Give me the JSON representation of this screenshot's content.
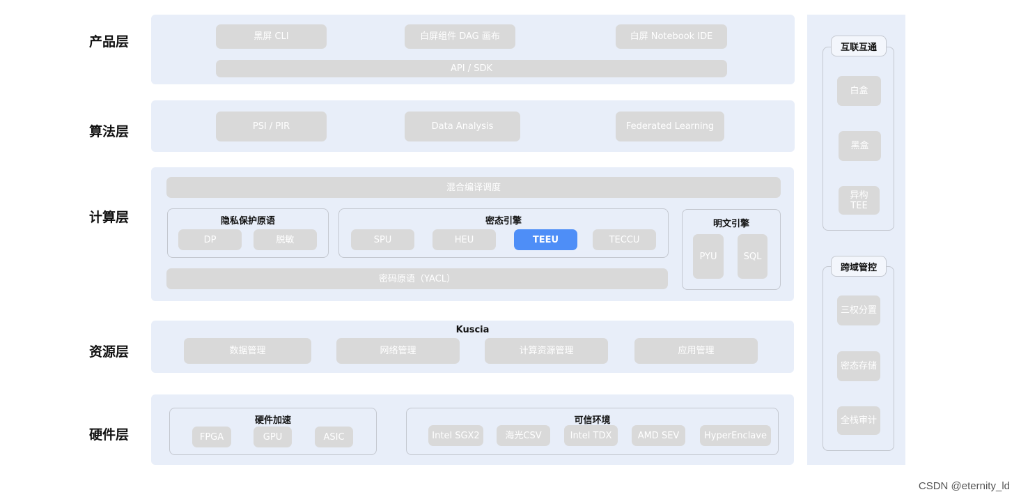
{
  "layers": {
    "product": "产品层",
    "algorithm": "算法层",
    "compute": "计算层",
    "resource": "资源层",
    "hardware": "硬件层"
  },
  "product": {
    "items": [
      "黑屏 CLI",
      "白屏组件 DAG 画布",
      "白屏 Notebook IDE"
    ],
    "api": "API / SDK"
  },
  "algorithm": {
    "items": [
      "PSI / PIR",
      "Data Analysis",
      "Federated Learning"
    ]
  },
  "compute": {
    "scheduler": "混合编译调度",
    "privacy": {
      "title": "隐私保护原语",
      "items": [
        "DP",
        "脱敏"
      ]
    },
    "cipher": {
      "title": "密态引擎",
      "items": [
        "SPU",
        "HEU",
        "TEEU",
        "TECCU"
      ],
      "active": "TEEU"
    },
    "plain": {
      "title": "明文引擎",
      "items": [
        "PYU",
        "SQL"
      ]
    },
    "yacl": "密码原语（YACL）"
  },
  "resource": {
    "title": "Kuscia",
    "items": [
      "数据管理",
      "网络管理",
      "计算资源管理",
      "应用管理"
    ]
  },
  "hardware": {
    "accel": {
      "title": "硬件加速",
      "items": [
        "FPGA",
        "GPU",
        "ASIC"
      ]
    },
    "trusted": {
      "title": "可信环境",
      "items": [
        "Intel SGX2",
        "海光CSV",
        "Intel TDX",
        "AMD SEV",
        "HyperEnclave"
      ]
    }
  },
  "side": {
    "interop": {
      "title": "互联互通",
      "items": [
        "白盒",
        "黑盒",
        "异构\nTEE"
      ]
    },
    "control": {
      "title": "跨域管控",
      "items": [
        "三权分置",
        "密态存储",
        "全栈审计"
      ]
    }
  },
  "watermark": "CSDN @eternity_ld",
  "colors": {
    "panel": "#e8eef9",
    "pill": "#d9d9d9",
    "active": "#4e8ef7"
  }
}
